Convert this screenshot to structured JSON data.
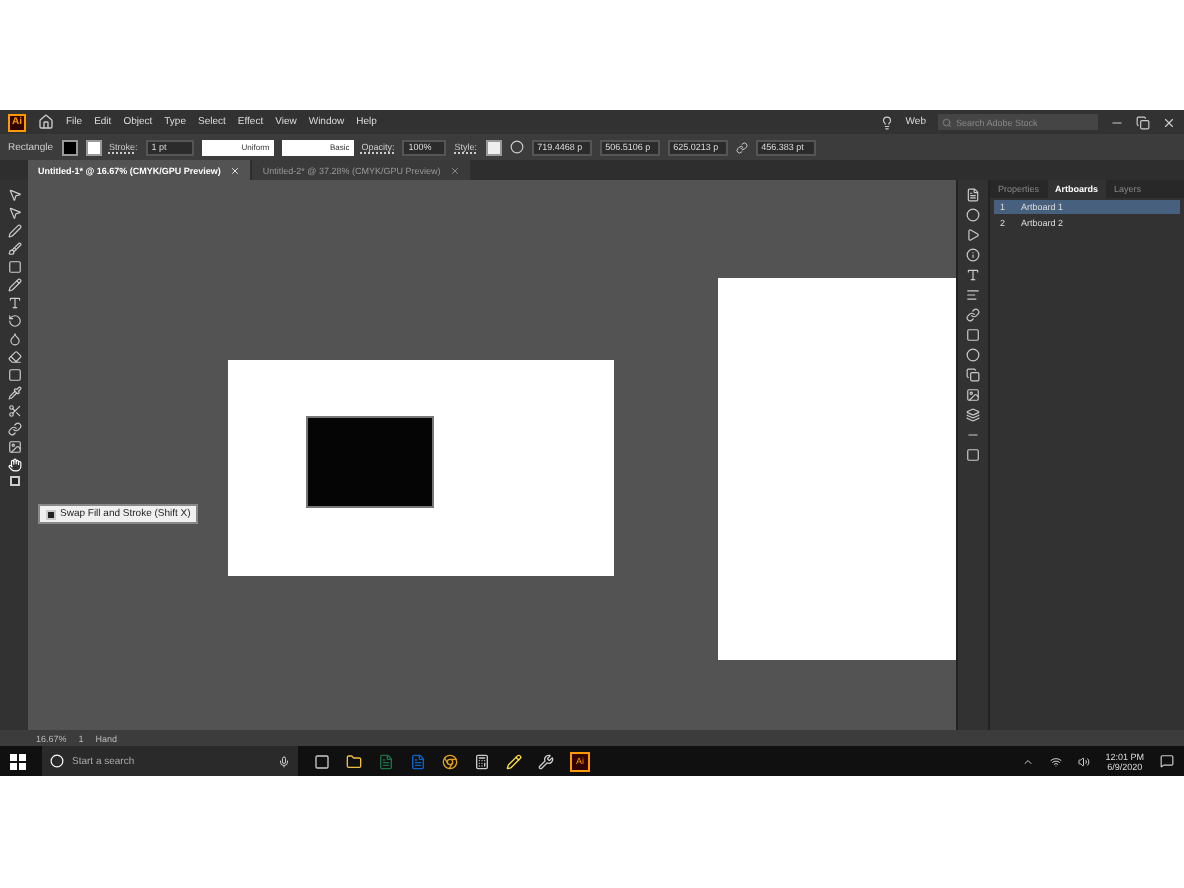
{
  "app_bar": {
    "logo": "Ai",
    "menu": [
      "File",
      "Edit",
      "Object",
      "Type",
      "Select",
      "Effect",
      "View",
      "Window",
      "Help"
    ],
    "workspace": "Web",
    "search": {
      "placeholder": "Search Adobe Stock"
    }
  },
  "control_bar": {
    "tool": "Rectangle",
    "stroke_label": "Stroke:",
    "stroke_weight": "1 pt",
    "profile": "Uniform",
    "brush": "Basic",
    "opacity_label": "Opacity:",
    "opacity": "100%",
    "style_label": "Style:",
    "x": "719.4468 p",
    "y": "506.5106 p",
    "w": "625.0213 p",
    "h": "456.383 pt"
  },
  "tabs": [
    {
      "label": "Untitled-1* @ 16.67% (CMYK/GPU Preview)",
      "selected": true
    },
    {
      "label": "Untitled-2* @ 37.28% (CMYK/GPU Preview)",
      "selected": false
    }
  ],
  "tooltip": "Swap Fill and Stroke (Shift X)",
  "panel": {
    "tabs": [
      {
        "label": "Properties",
        "selected": false
      },
      {
        "label": "Artboards",
        "selected": true
      },
      {
        "label": "Layers",
        "selected": false
      }
    ],
    "artboards": [
      {
        "number": "1",
        "name": "Artboard 1",
        "selected": true
      },
      {
        "number": "2",
        "name": "Artboard 2",
        "selected": false
      }
    ]
  },
  "status_bar": {
    "zoom": "16.67%",
    "artboard": "1",
    "tool": "Hand"
  },
  "taskbar": {
    "app_logo": "Ai",
    "search_placeholder": "Start a search",
    "time": "12:01 PM",
    "date": "6/9/2020"
  }
}
